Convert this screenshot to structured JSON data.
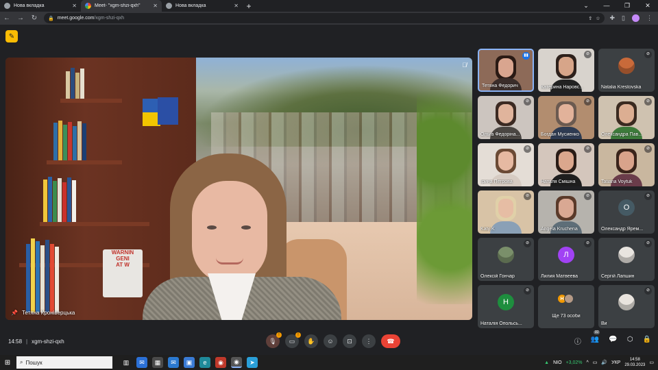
{
  "browser": {
    "tabs": [
      {
        "title": "Нова вкладка",
        "active": false
      },
      {
        "title": "Meet- \"xgm-shzi-qxh\"",
        "active": true
      },
      {
        "title": "Нова вкладка",
        "active": false
      }
    ],
    "new_tab_label": "+",
    "url_host": "meet.google.com",
    "url_path": "/xgm-shzi-qxh"
  },
  "main_speaker": {
    "name": "Тетяна Кроніверцька",
    "sign_lines": [
      "WARNIN",
      "GENI",
      "AT W"
    ]
  },
  "participants": [
    {
      "name": "Тетяна Федорич",
      "type": "video",
      "speaking": true,
      "bg": "#8d6a58",
      "skin": "#d9a58f",
      "hair": "#2a1a14",
      "cloth": "#3a2d2a"
    },
    {
      "name": "Катерина Наровс...",
      "type": "video",
      "speaking": false,
      "bg": "#d8d3cd",
      "skin": "#d7a589",
      "hair": "#2d201b",
      "cloth": "#222"
    },
    {
      "name": "Natalia Krestovska",
      "type": "avatar-photo",
      "speaking": false,
      "avatar_color": "#c96a3a"
    },
    {
      "name": "Ольга Федоріна...",
      "type": "video",
      "speaking": false,
      "bg": "#ccc5bf",
      "skin": "#e0b49c",
      "hair": "#3b2a22",
      "cloth": "#4a4642"
    },
    {
      "name": "Богдан Мусиенко",
      "type": "video",
      "speaking": false,
      "bg": "#b28d6f",
      "skin": "#e2b29a",
      "hair": "#6b5a50",
      "cloth": "#2e3b52"
    },
    {
      "name": "Олександра Пав...",
      "type": "video",
      "speaking": false,
      "bg": "#cfc2b0",
      "skin": "#dcae92",
      "hair": "#3a2a20",
      "cloth": "#3c7a3a"
    },
    {
      "name": "Ірина Петрова",
      "type": "video",
      "speaking": false,
      "bg": "#e4ddd6",
      "skin": "#e6b9a2",
      "hair": "#6b4a35",
      "cloth": "#d6cbc2"
    },
    {
      "name": "Наталя Смішна",
      "type": "video",
      "speaking": false,
      "bg": "#d4c6bc",
      "skin": "#dba78d",
      "hair": "#2a1c16",
      "cloth": "#1e1e1e"
    },
    {
      "name": "Tatiana Voytuk",
      "type": "video",
      "speaking": false,
      "bg": "#c9b79f",
      "skin": "#d9a38b",
      "hair": "#3a241b",
      "cloth": "#6a3c4a"
    },
    {
      "name": "Katy K",
      "type": "video",
      "speaking": false,
      "bg": "#d8c3a6",
      "skin": "#e6bda4",
      "hair": "#e0d0a8",
      "cloth": "#8aa0b6"
    },
    {
      "name": "Angela Kruchena",
      "type": "video",
      "speaking": false,
      "bg": "#b6b3ad",
      "skin": "#d9a893",
      "hair": "#5a3a2a",
      "cloth": "#5e6e78"
    },
    {
      "name": "Олександр Ярем...",
      "type": "initial",
      "initial": "О",
      "color": "#455a64"
    },
    {
      "name": "Олексій Гончар",
      "type": "avatar-photo",
      "speaking": false,
      "avatar_color": "#7a8f6a"
    },
    {
      "name": "Лилия Матвеева",
      "type": "initial",
      "initial": "Л",
      "color": "#a142f4"
    },
    {
      "name": "Сергій Лапшин",
      "type": "avatar-photo",
      "speaking": false,
      "avatar_color": "#e8e4df"
    },
    {
      "name": "Наталія Опольсь...",
      "type": "initial",
      "initial": "Н",
      "color": "#1e8e3e"
    },
    {
      "name": "Ще 73 особи",
      "type": "more",
      "initial": "Н",
      "color": "#f29900"
    },
    {
      "name": "Ви",
      "type": "avatar-photo",
      "speaking": false,
      "avatar_color": "#e9e4de"
    }
  ],
  "meeting": {
    "time": "14:58",
    "separator": "|",
    "code": "xgm-shzi-qxh",
    "participants_count": "91"
  },
  "taskbar": {
    "search_placeholder": "Пошук",
    "stock_name": "NIO",
    "stock_change": "+3,02%",
    "language": "УКР",
    "clock_time": "14:58",
    "clock_date": "29.03.2023"
  }
}
